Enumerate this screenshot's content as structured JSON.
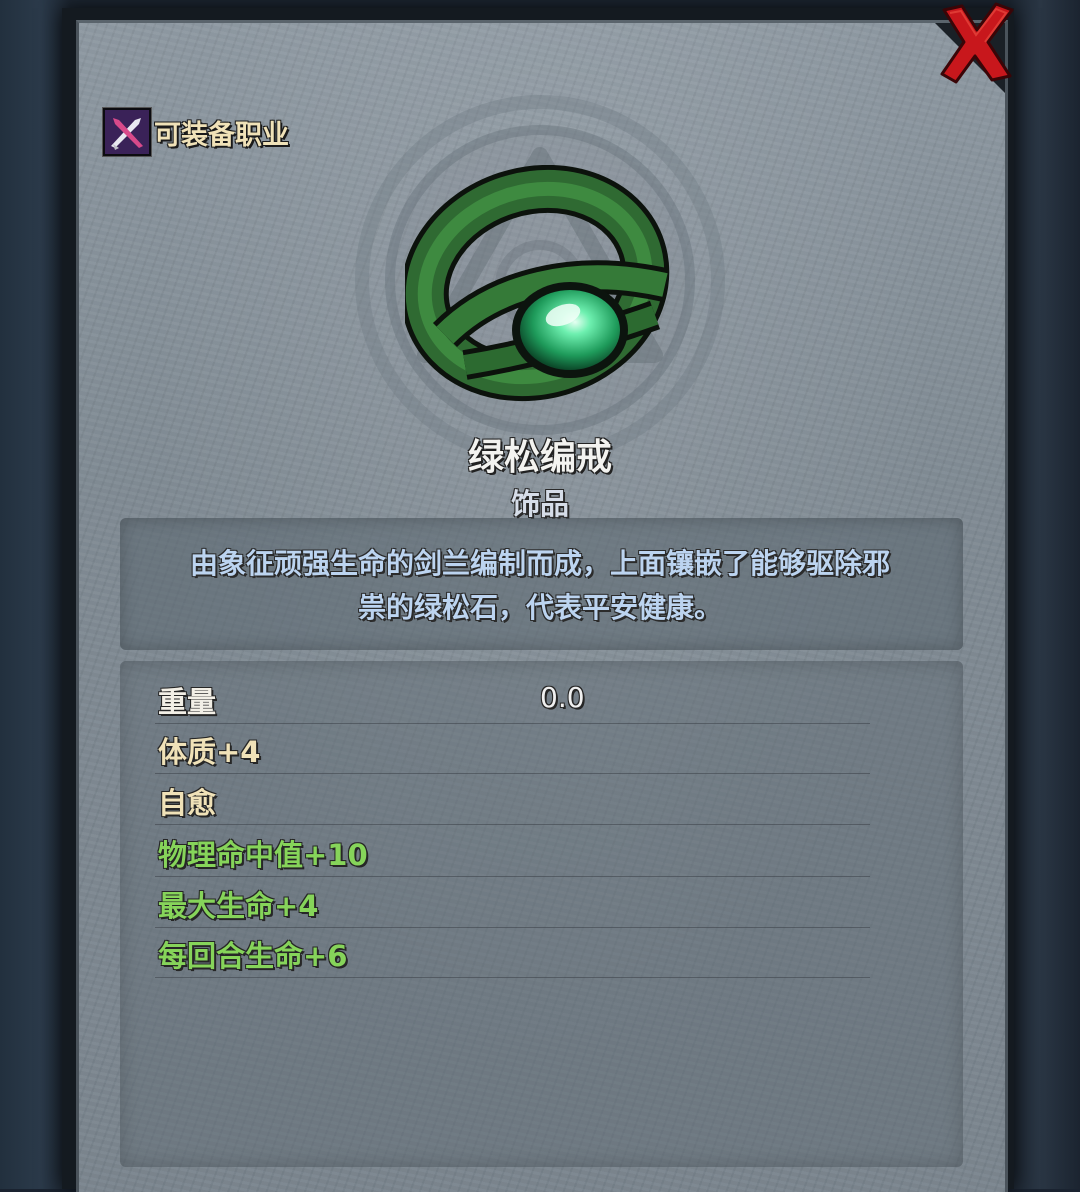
{
  "header": {
    "equip_class_label": "可装备职业",
    "equip_class_icon": "crossed-swords-class-icon"
  },
  "close_icon": "close-x-icon",
  "item": {
    "name": "绿松编戒",
    "type": "饰品",
    "image_icon": "green-braided-turquoise-ring",
    "description_line1": "由象征顽强生命的剑兰编制而成，上面镶嵌了能够驱除邪",
    "description_line2": "祟的绿松石，代表平安健康。"
  },
  "stats": {
    "weight": {
      "label": "重量",
      "value": "0.0"
    },
    "rows": [
      {
        "label": "体质+4"
      },
      {
        "label": "自愈"
      },
      {
        "label": "物理命中值+10"
      },
      {
        "label": "最大生命+4"
      },
      {
        "label": "每回合生命+6"
      }
    ]
  },
  "colors": {
    "accent_red": "#d0161b",
    "stat_green": "#86d45a",
    "stat_tan": "#f0e2b8",
    "description_blue": "#bcd4f0"
  }
}
